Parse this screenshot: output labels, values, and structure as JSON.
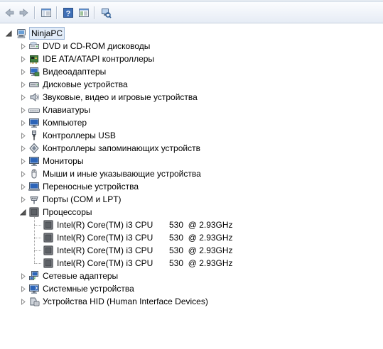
{
  "toolbar": {
    "buttons": [
      {
        "name": "back-button",
        "icon": "arrow-left-icon"
      },
      {
        "name": "forward-button",
        "icon": "arrow-right-icon"
      },
      {
        "name": "show-hide-console-tree-button",
        "icon": "console-tree-icon"
      },
      {
        "name": "help-button",
        "icon": "help-icon"
      },
      {
        "name": "properties-view-button",
        "icon": "properties-icon"
      },
      {
        "name": "scan-hardware-button",
        "icon": "scan-hardware-icon"
      }
    ]
  },
  "tree": {
    "root": {
      "label": "NinjaPC",
      "icon": "computer-icon",
      "expanded": true
    },
    "categories": [
      {
        "label": "DVD и CD-ROM дисководы",
        "icon": "dvd-drive-icon",
        "expanded": false
      },
      {
        "label": "IDE ATA/ATAPI контроллеры",
        "icon": "ide-controller-icon",
        "expanded": false
      },
      {
        "label": "Видеоадаптеры",
        "icon": "display-adapter-icon",
        "expanded": false
      },
      {
        "label": "Дисковые устройства",
        "icon": "disk-drive-icon",
        "expanded": false
      },
      {
        "label": "Звуковые, видео и игровые устройства",
        "icon": "speaker-icon",
        "expanded": false
      },
      {
        "label": "Клавиатуры",
        "icon": "keyboard-icon",
        "expanded": false
      },
      {
        "label": "Компьютер",
        "icon": "monitor-icon",
        "expanded": false
      },
      {
        "label": "Контроллеры USB",
        "icon": "usb-icon",
        "expanded": false
      },
      {
        "label": "Контроллеры запоминающих устройств",
        "icon": "storage-controller-icon",
        "expanded": false
      },
      {
        "label": "Мониторы",
        "icon": "monitor-icon",
        "expanded": false
      },
      {
        "label": "Мыши и иные указывающие устройства",
        "icon": "mouse-icon",
        "expanded": false
      },
      {
        "label": "Переносные устройства",
        "icon": "portable-device-icon",
        "expanded": false
      },
      {
        "label": "Порты (COM и LPT)",
        "icon": "port-icon",
        "expanded": false
      },
      {
        "label": "Процессоры",
        "icon": "processor-icon",
        "expanded": true,
        "children": [
          {
            "name": "Intel(R) Core(TM) i3 CPU",
            "model": "530  @ 2.93GHz",
            "icon": "processor-icon"
          },
          {
            "name": "Intel(R) Core(TM) i3 CPU",
            "model": "530  @ 2.93GHz",
            "icon": "processor-icon"
          },
          {
            "name": "Intel(R) Core(TM) i3 CPU",
            "model": "530  @ 2.93GHz",
            "icon": "processor-icon"
          },
          {
            "name": "Intel(R) Core(TM) i3 CPU",
            "model": "530  @ 2.93GHz",
            "icon": "processor-icon"
          }
        ]
      },
      {
        "label": "Сетевые адаптеры",
        "icon": "network-adapter-icon",
        "expanded": false
      },
      {
        "label": "Системные устройства",
        "icon": "system-device-icon",
        "expanded": false
      },
      {
        "label": "Устройства HID (Human Interface Devices)",
        "icon": "hid-icon",
        "expanded": false
      }
    ]
  }
}
